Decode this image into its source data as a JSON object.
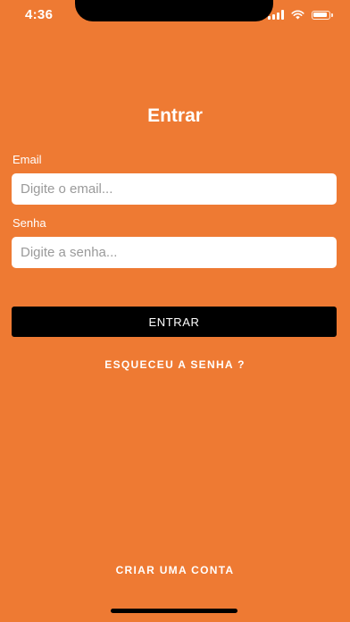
{
  "status_bar": {
    "time": "4:36",
    "icons": [
      "signal-icon",
      "wifi-icon",
      "battery-icon"
    ]
  },
  "login": {
    "title": "Entrar",
    "email_label": "Email",
    "email_placeholder": "Digite o email...",
    "email_value": "",
    "password_label": "Senha",
    "password_placeholder": "Digite a senha...",
    "password_value": "",
    "submit_label": "ENTRAR",
    "forgot_label": "ESQUECEU A SENHA ?",
    "create_account_label": "CRIAR UMA CONTA"
  },
  "colors": {
    "background": "#EE7A33",
    "button": "#000000",
    "input_background": "#FFFFFF",
    "text": "#FFFFFF"
  }
}
